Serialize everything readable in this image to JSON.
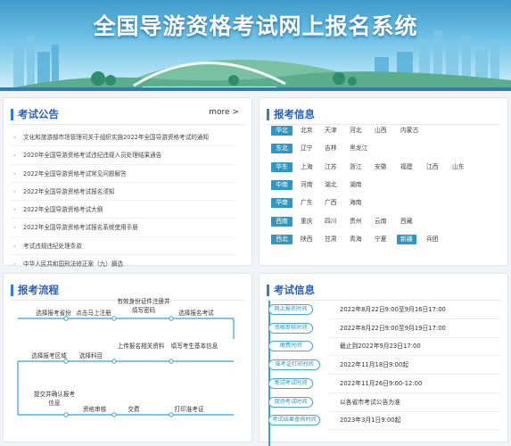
{
  "banner": {
    "title": "全国导游资格考试网上报名系统"
  },
  "notices": {
    "title": "考试公告",
    "more": "more >",
    "items": [
      "文化和旅游部市场管理司关于组织实施2022年全国导游资格考试的通知",
      "2020年全国导游资格考试违纪违规人员处理结果通告",
      "2022年全国导游资格考试常见问题解答",
      "2022年全国导游资格考试报名须知",
      "2022年全国导游资格考试大纲",
      "2022年全国导游资格考试报名系统使用手册",
      "考试违规违纪处理条款",
      "中华人民共和国刑法修正案（九）摘选"
    ]
  },
  "regions": {
    "title": "报考信息",
    "rows": [
      {
        "region": "华北",
        "cities": [
          "北京",
          "天津",
          "河北",
          "山西",
          "内蒙古"
        ]
      },
      {
        "region": "东北",
        "cities": [
          "辽宁",
          "吉林",
          "黑龙江"
        ]
      },
      {
        "region": "华东",
        "cities": [
          "上海",
          "江苏",
          "浙江",
          "安徽",
          "福建",
          "江西",
          "山东"
        ]
      },
      {
        "region": "中南",
        "cities": [
          "河南",
          "湖北",
          "湖南"
        ]
      },
      {
        "region": "华南",
        "cities": [
          "广东",
          "广西",
          "海南"
        ]
      },
      {
        "region": "西南",
        "cities": [
          "重庆",
          "四川",
          "贵州",
          "云南",
          "西藏"
        ]
      },
      {
        "region": "西北",
        "cities": [
          "陕西",
          "甘肃",
          "青海",
          "宁夏",
          "新疆",
          "兵团"
        ]
      }
    ],
    "highlighted_city": "新疆"
  },
  "flow": {
    "title": "报考流程",
    "steps": [
      "选择报考省份",
      "点击马上注册",
      "有效身份证件注册并填写密码",
      "选择报名考试",
      "选择报考区域",
      "选择科目",
      "上传报名相关资料",
      "填写考生基本信息",
      "提交并确认报考信息",
      "资格审核",
      "交费",
      "打印准考证"
    ]
  },
  "schedule": {
    "title": "考试信息",
    "rows": [
      {
        "label": "网上报名时间",
        "value": "2022年8月22日9:00至9月16日17:00"
      },
      {
        "label": "资格审核时间",
        "value": "2022年8月22日9:00至9月19日17:00"
      },
      {
        "label": "缴费时间",
        "value": "截止到2022年9月23日17:00"
      },
      {
        "label": "准考证打印时间",
        "value": "2022年11月18日9:00起"
      },
      {
        "label": "笔试考试时间",
        "value": "2022年11月26日9:00-12:00"
      },
      {
        "label": "现场考试时间",
        "value": "以各省市考试公告为准"
      },
      {
        "label": "考试结果查询时间",
        "value": "2023年3月1日9:00起"
      }
    ]
  },
  "colors": {
    "accent": "#2f97c2",
    "title_blue": "#2b62b3",
    "background": "#f1f3f6"
  }
}
